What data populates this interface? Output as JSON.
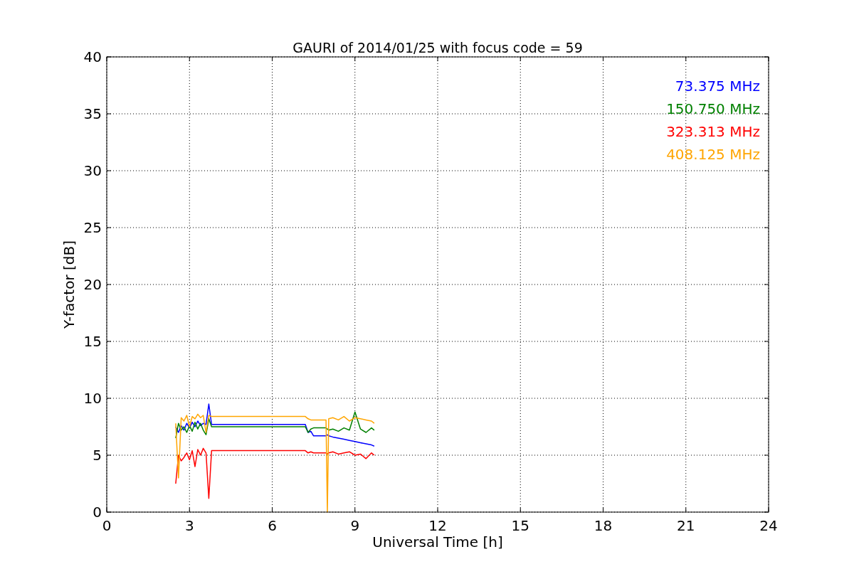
{
  "chart_data": {
    "type": "line",
    "title": "GAURI of 2014/01/25 with focus code = 59",
    "xlabel": "Universal Time [h]",
    "ylabel": "Y-factor [dB]",
    "x": [
      2.5,
      2.6,
      2.7,
      2.8,
      2.9,
      3.0,
      3.1,
      3.2,
      3.3,
      3.4,
      3.5,
      3.6,
      3.7,
      3.8,
      3.9,
      7.2,
      7.3,
      7.4,
      7.5,
      7.95,
      8.0,
      8.05,
      8.2,
      8.4,
      8.6,
      8.8,
      9.0,
      9.2,
      9.4,
      9.6,
      9.7
    ],
    "series": [
      {
        "name": "73.375 MHz",
        "color": "#0000ff",
        "values": [
          7.5,
          7.0,
          7.6,
          7.2,
          7.8,
          7.4,
          7.9,
          7.5,
          8.0,
          7.6,
          7.8,
          7.7,
          9.5,
          7.7,
          7.7,
          7.7,
          7.0,
          7.1,
          6.7,
          6.7,
          6.8,
          6.7,
          6.6,
          6.5,
          6.4,
          6.3,
          6.2,
          6.1,
          6.0,
          5.9,
          5.8
        ]
      },
      {
        "name": "150.750 MHz",
        "color": "#008000",
        "values": [
          6.5,
          7.8,
          7.2,
          7.5,
          7.0,
          7.6,
          7.1,
          7.9,
          7.3,
          7.8,
          7.2,
          6.8,
          8.2,
          7.5,
          7.5,
          7.5,
          7.0,
          7.3,
          7.4,
          7.4,
          7.3,
          7.2,
          7.3,
          7.1,
          7.4,
          7.2,
          8.8,
          7.3,
          7.0,
          7.4,
          7.2
        ]
      },
      {
        "name": "323.313 MHz",
        "color": "#ff0000",
        "values": [
          2.5,
          5.0,
          4.5,
          4.8,
          5.2,
          4.6,
          5.4,
          4.0,
          5.5,
          5.0,
          5.6,
          5.2,
          1.2,
          5.4,
          5.4,
          5.4,
          5.2,
          5.3,
          5.2,
          5.2,
          5.1,
          5.2,
          5.3,
          5.1,
          5.2,
          5.3,
          5.0,
          5.1,
          4.7,
          5.2,
          5.0
        ]
      },
      {
        "name": "408.125 MHz",
        "color": "#ffa500",
        "values": [
          7.8,
          3.0,
          8.3,
          8.0,
          8.5,
          7.5,
          8.4,
          8.2,
          8.6,
          8.3,
          8.5,
          7.0,
          8.5,
          8.4,
          8.4,
          8.4,
          8.2,
          8.1,
          8.1,
          8.1,
          0,
          8.2,
          8.3,
          8.1,
          8.4,
          8.0,
          8.3,
          8.2,
          8.1,
          8.0,
          7.8
        ]
      }
    ],
    "xlim": [
      0,
      24
    ],
    "ylim": [
      0,
      40
    ],
    "xticks": [
      0,
      3,
      6,
      9,
      12,
      15,
      18,
      21,
      24
    ],
    "yticks": [
      0,
      5,
      10,
      15,
      20,
      25,
      30,
      35,
      40
    ],
    "grid": true
  }
}
